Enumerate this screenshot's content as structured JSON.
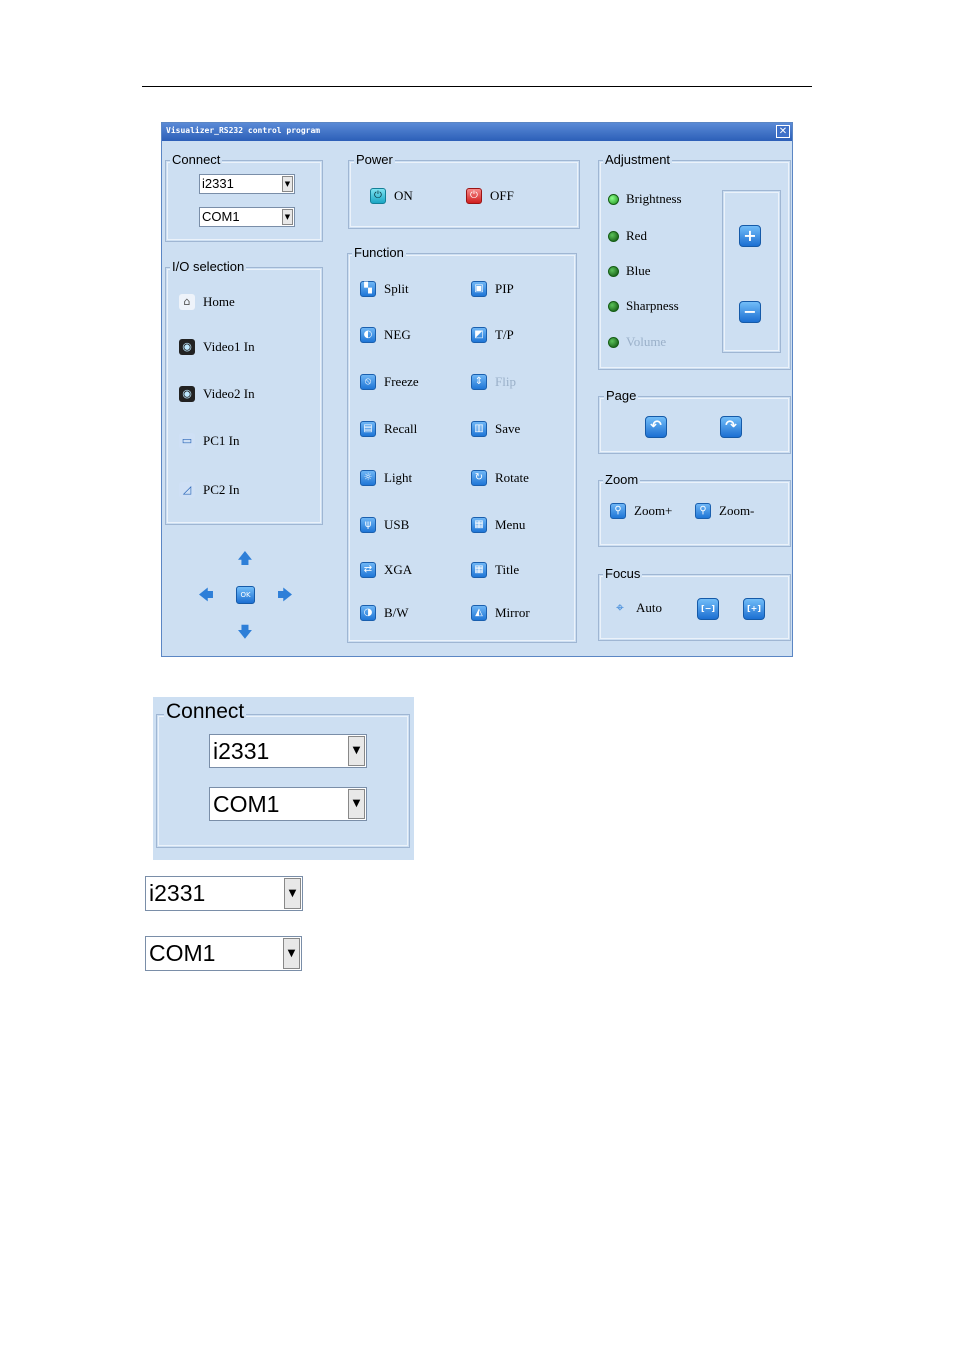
{
  "window": {
    "title": "Visualizer_RS232 control program",
    "close_glyph": "✕"
  },
  "connect": {
    "label": "Connect",
    "model_value": "i2331",
    "port_value": "COM1"
  },
  "power": {
    "label": "Power",
    "on_label": "ON",
    "off_label": "OFF"
  },
  "io": {
    "label": "I/O selection",
    "items": [
      {
        "label": "Home",
        "icon": "home-icon"
      },
      {
        "label": "Video1 In",
        "icon": "camera-icon"
      },
      {
        "label": "Video2 In",
        "icon": "camera-icon"
      },
      {
        "label": "PC1 In",
        "icon": "computer-icon"
      },
      {
        "label": "PC2 In",
        "icon": "laptop-icon"
      }
    ]
  },
  "function": {
    "label": "Function",
    "items": [
      {
        "label": "Split",
        "glyph": "▚"
      },
      {
        "label": "PIP",
        "glyph": "▣"
      },
      {
        "label": "NEG",
        "glyph": "◐"
      },
      {
        "label": "T/P",
        "glyph": "◩"
      },
      {
        "label": "Freeze",
        "glyph": "⦸"
      },
      {
        "label": "Flip",
        "glyph": "⇕"
      },
      {
        "label": "Recall",
        "glyph": "▤"
      },
      {
        "label": "Save",
        "glyph": "▥"
      },
      {
        "label": "Light",
        "glyph": "☼"
      },
      {
        "label": "Rotate",
        "glyph": "↻"
      },
      {
        "label": "USB",
        "glyph": "ψ"
      },
      {
        "label": "Menu",
        "glyph": "▦"
      },
      {
        "label": "XGA",
        "glyph": "⇄"
      },
      {
        "label": "Title",
        "glyph": "▦"
      },
      {
        "label": "B/W",
        "glyph": "◑"
      },
      {
        "label": "Mirror",
        "glyph": "◭"
      }
    ]
  },
  "adjustment": {
    "label": "Adjustment",
    "items": [
      "Brightness",
      "Red",
      "Blue",
      "Sharpness",
      "Volume"
    ],
    "plus": "+",
    "minus": "−"
  },
  "page": {
    "label": "Page",
    "prev_glyph": "↶",
    "next_glyph": "↷"
  },
  "zoom": {
    "label": "Zoom",
    "in_label": "Zoom+",
    "out_label": "Zoom-"
  },
  "focus": {
    "label": "Focus",
    "auto_label": "Auto",
    "near_glyph": "[−]",
    "far_glyph": "[+]"
  },
  "nav": {
    "up": "🡅",
    "down": "🡇",
    "left": "🡄",
    "right": "🡆",
    "ok": "OK"
  },
  "zoomed_views": {
    "connect_label": "Connect",
    "model_value": "i2331",
    "port_value": "COM1"
  }
}
